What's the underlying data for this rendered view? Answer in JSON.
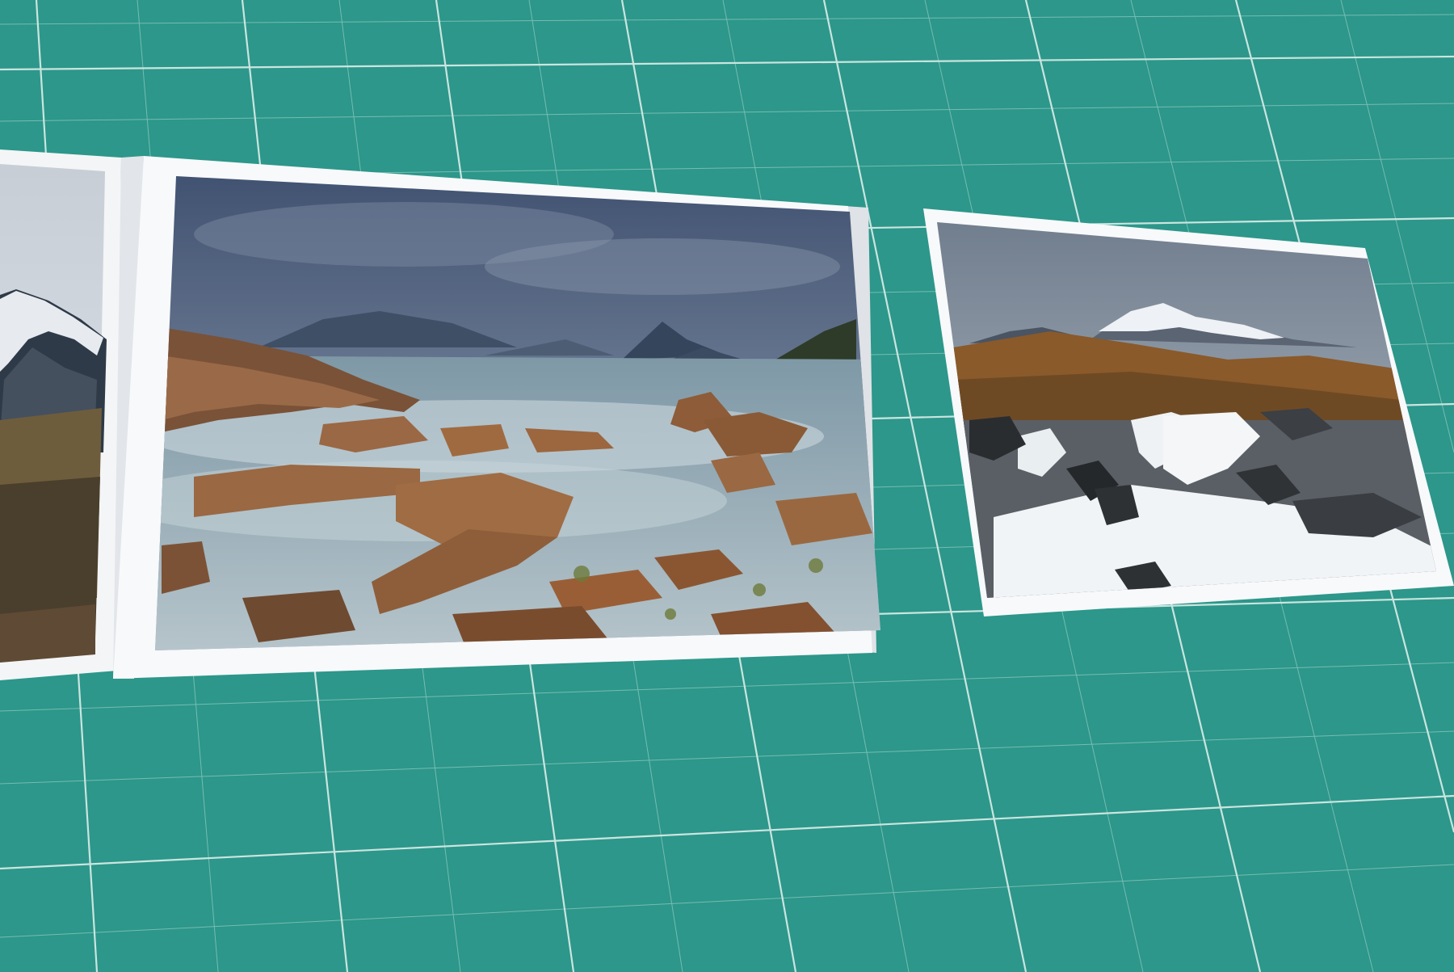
{
  "scene": {
    "description_tags": [
      "cutting-mat",
      "photo-print",
      "folded-card"
    ],
    "colors": {
      "mat": "#2c978a",
      "mat_grid": "#e8f4f0",
      "paper": "#f7f8fa",
      "sky": "#5e6d86",
      "sea": "#8aa1ae",
      "rock": "#8a5a38",
      "snow": "#e9edf2",
      "heather": "#8a5a2a"
    }
  }
}
